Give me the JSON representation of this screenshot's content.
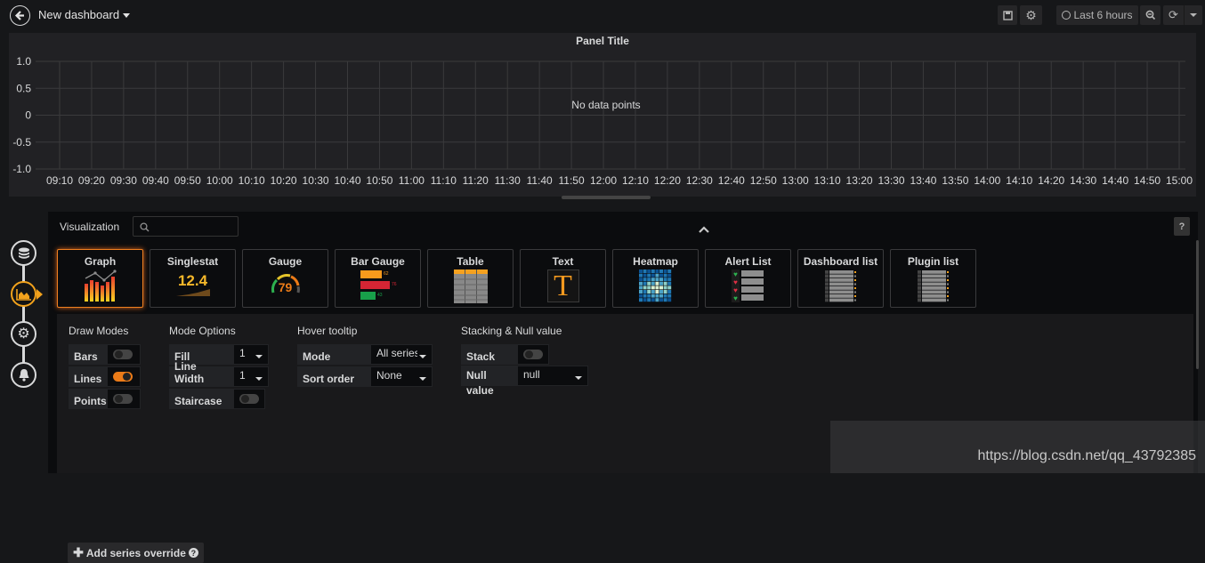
{
  "topbar": {
    "dashboard_title": "New dashboard",
    "time_range": "Last 6 hours",
    "icons": [
      "back-arrow-icon",
      "save-icon",
      "gear-icon",
      "clock-icon",
      "zoom-out-icon",
      "refresh-icon",
      "caret-down-icon"
    ]
  },
  "panel": {
    "title": "Panel Title",
    "empty_message": "No data points"
  },
  "chart_data": {
    "type": "line",
    "title": "Panel Title",
    "xlabel": "",
    "ylabel": "",
    "series": [],
    "yticks": [
      "1.0",
      "0.5",
      "0",
      "-0.5",
      "-1.0"
    ],
    "ylim": [
      -1.0,
      1.0
    ],
    "xticks": [
      "09:10",
      "09:20",
      "09:30",
      "09:40",
      "09:50",
      "10:00",
      "10:10",
      "10:20",
      "10:30",
      "10:40",
      "10:50",
      "11:00",
      "11:10",
      "11:20",
      "11:30",
      "11:40",
      "11:50",
      "12:00",
      "12:10",
      "12:20",
      "12:30",
      "12:40",
      "12:50",
      "13:00",
      "13:10",
      "13:20",
      "13:30",
      "13:40",
      "13:50",
      "14:00",
      "14:10",
      "14:20",
      "14:30",
      "14:40",
      "14:50",
      "15:00"
    ],
    "grid": true,
    "annotation": "No data points"
  },
  "sidenav": {
    "items": [
      {
        "name": "queries",
        "icon": "database-icon"
      },
      {
        "name": "visualization",
        "icon": "chart-area-icon",
        "active": true
      },
      {
        "name": "general",
        "icon": "settings-icon"
      },
      {
        "name": "alert",
        "icon": "bell-icon"
      }
    ]
  },
  "editor": {
    "visualization_label": "Visualization",
    "search_placeholder": "",
    "help_label": "?",
    "cards": [
      {
        "name": "Graph",
        "selected": true
      },
      {
        "name": "Singlestat",
        "value": "12.4"
      },
      {
        "name": "Gauge",
        "value": "79"
      },
      {
        "name": "Bar Gauge",
        "values": [
          "62",
          "76",
          "43"
        ]
      },
      {
        "name": "Table"
      },
      {
        "name": "Text",
        "glyph": "T"
      },
      {
        "name": "Heatmap"
      },
      {
        "name": "Alert List"
      },
      {
        "name": "Dashboard list"
      },
      {
        "name": "Plugin list"
      }
    ],
    "draw_modes": {
      "title": "Draw Modes",
      "bars": {
        "label": "Bars",
        "on": false
      },
      "lines": {
        "label": "Lines",
        "on": true
      },
      "points": {
        "label": "Points",
        "on": false
      }
    },
    "mode_options": {
      "title": "Mode Options",
      "fill": {
        "label": "Fill",
        "value": "1"
      },
      "line_width": {
        "label": "Line Width",
        "value": "1"
      },
      "staircase": {
        "label": "Staircase",
        "on": false
      }
    },
    "hover_tooltip": {
      "title": "Hover tooltip",
      "mode": {
        "label": "Mode",
        "value": "All series"
      },
      "sort_order": {
        "label": "Sort order",
        "value": "None"
      }
    },
    "stacking": {
      "title": "Stacking & Null value",
      "stack": {
        "label": "Stack",
        "on": false
      },
      "null_value": {
        "label": "Null value",
        "value": "null"
      }
    },
    "add_override": "Add series override"
  },
  "watermark": "https://blog.csdn.net/qq_43792385"
}
